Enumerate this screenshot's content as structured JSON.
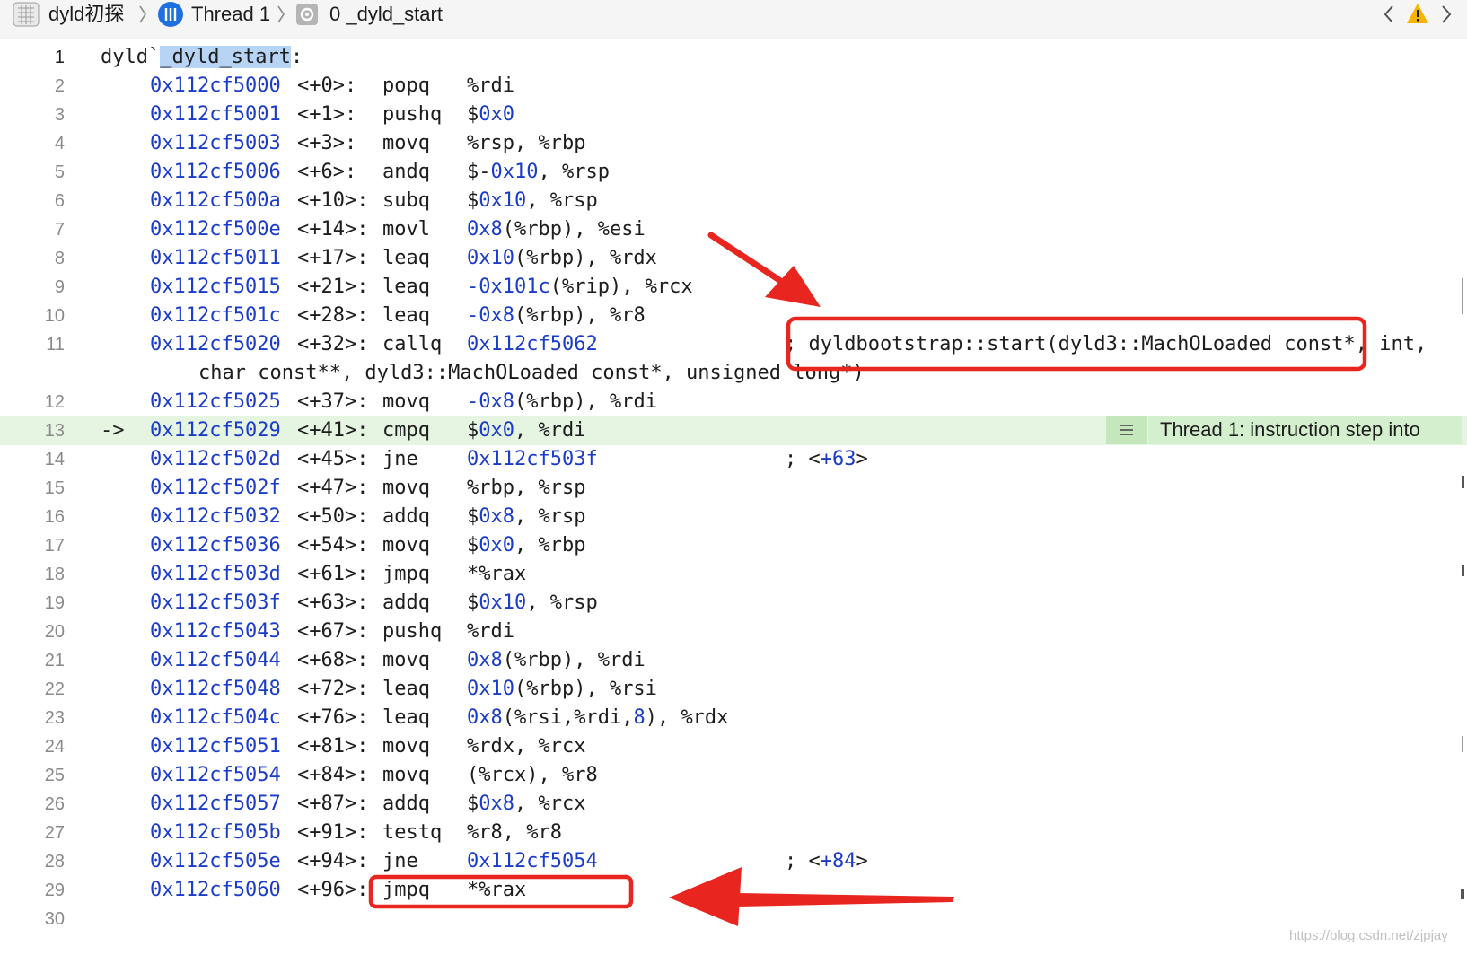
{
  "breadcrumb": {
    "project": "dyld初探",
    "thread": "Thread 1",
    "frame": "0 _dyld_start"
  },
  "banner": {
    "text": "Thread 1: instruction step into"
  },
  "lines": {
    "l1": {
      "num": "1",
      "prefix": "dyld`",
      "sym": "_dyld_start",
      "suffix": ":"
    },
    "l2": {
      "num": "2",
      "addr": "0x112cf5000",
      "off": "<+0>:",
      "op": "popq",
      "args": "%rdi"
    },
    "l3": {
      "num": "3",
      "addr": "0x112cf5001",
      "off": "<+1>:",
      "op": "pushq",
      "a1": "$",
      "a2": "0x0"
    },
    "l4": {
      "num": "4",
      "addr": "0x112cf5003",
      "off": "<+3>:",
      "op": "movq",
      "args": "%rsp, %rbp"
    },
    "l5": {
      "num": "5",
      "addr": "0x112cf5006",
      "off": "<+6>:",
      "op": "andq",
      "a1": "$-",
      "a2": "0x10",
      "a3": ", %rsp"
    },
    "l6": {
      "num": "6",
      "addr": "0x112cf500a",
      "off": "<+10>:",
      "op": "subq",
      "a1": "$",
      "a2": "0x10",
      "a3": ", %rsp"
    },
    "l7": {
      "num": "7",
      "addr": "0x112cf500e",
      "off": "<+14>:",
      "op": "movl",
      "a2": "0x8",
      "a3": "(%rbp), %esi"
    },
    "l8": {
      "num": "8",
      "addr": "0x112cf5011",
      "off": "<+17>:",
      "op": "leaq",
      "a2": "0x10",
      "a3": "(%rbp), %rdx"
    },
    "l9": {
      "num": "9",
      "addr": "0x112cf5015",
      "off": "<+21>:",
      "op": "leaq",
      "a1": "-",
      "a2": "0x101c",
      "a3": "(%rip), %rcx"
    },
    "l10": {
      "num": "10",
      "addr": "0x112cf501c",
      "off": "<+28>:",
      "op": "leaq",
      "a1": "-",
      "a2": "0x8",
      "a3": "(%rbp), %r8"
    },
    "l11": {
      "num": "11",
      "addr": "0x112cf5020",
      "off": "<+32>:",
      "op": "callq",
      "a2": "0x112cf5062",
      "comment": "; dyldbootstrap::start(dyld3::MachOLoaded const*, int,",
      "cont": "char const**, dyld3::MachOLoaded const*, unsigned long*)"
    },
    "l12": {
      "num": "12",
      "addr": "0x112cf5025",
      "off": "<+37>:",
      "op": "movq",
      "a1": "-",
      "a2": "0x8",
      "a3": "(%rbp), %rdi"
    },
    "l13": {
      "num": "13",
      "pc": "->",
      "addr": "0x112cf5029",
      "off": "<+41>:",
      "op": "cmpq",
      "a1": "$",
      "a2": "0x0",
      "a3": ", %rdi"
    },
    "l14": {
      "num": "14",
      "addr": "0x112cf502d",
      "off": "<+45>:",
      "op": "jne",
      "a2": "0x112cf503f",
      "comment_a": "; <",
      "comment_b": "+63",
      "comment_c": ">"
    },
    "l15": {
      "num": "15",
      "addr": "0x112cf502f",
      "off": "<+47>:",
      "op": "movq",
      "args": "%rbp, %rsp"
    },
    "l16": {
      "num": "16",
      "addr": "0x112cf5032",
      "off": "<+50>:",
      "op": "addq",
      "a1": "$",
      "a2": "0x8",
      "a3": ", %rsp"
    },
    "l17": {
      "num": "17",
      "addr": "0x112cf5036",
      "off": "<+54>:",
      "op": "movq",
      "a1": "$",
      "a2": "0x0",
      "a3": ", %rbp"
    },
    "l18": {
      "num": "18",
      "addr": "0x112cf503d",
      "off": "<+61>:",
      "op": "jmpq",
      "args": "*%rax"
    },
    "l19": {
      "num": "19",
      "addr": "0x112cf503f",
      "off": "<+63>:",
      "op": "addq",
      "a1": "$",
      "a2": "0x10",
      "a3": ", %rsp"
    },
    "l20": {
      "num": "20",
      "addr": "0x112cf5043",
      "off": "<+67>:",
      "op": "pushq",
      "args": "%rdi"
    },
    "l21": {
      "num": "21",
      "addr": "0x112cf5044",
      "off": "<+68>:",
      "op": "movq",
      "a2": "0x8",
      "a3": "(%rbp), %rdi"
    },
    "l22": {
      "num": "22",
      "addr": "0x112cf5048",
      "off": "<+72>:",
      "op": "leaq",
      "a2": "0x10",
      "a3": "(%rbp), %rsi"
    },
    "l23": {
      "num": "23",
      "addr": "0x112cf504c",
      "off": "<+76>:",
      "op": "leaq",
      "a2": "0x8",
      "a3": "(%rsi,%rdi,",
      "a4": "8",
      "a5": "), %rdx"
    },
    "l24": {
      "num": "24",
      "addr": "0x112cf5051",
      "off": "<+81>:",
      "op": "movq",
      "args": "%rdx, %rcx"
    },
    "l25": {
      "num": "25",
      "addr": "0x112cf5054",
      "off": "<+84>:",
      "op": "movq",
      "args": "(%rcx), %r8"
    },
    "l26": {
      "num": "26",
      "addr": "0x112cf5057",
      "off": "<+87>:",
      "op": "addq",
      "a1": "$",
      "a2": "0x8",
      "a3": ", %rcx"
    },
    "l27": {
      "num": "27",
      "addr": "0x112cf505b",
      "off": "<+91>:",
      "op": "testq",
      "args": "%r8, %r8"
    },
    "l28": {
      "num": "28",
      "addr": "0x112cf505e",
      "off": "<+94>:",
      "op": "jne",
      "a2": "0x112cf5054",
      "comment_a": "; <",
      "comment_b": "+84",
      "comment_c": ">"
    },
    "l29": {
      "num": "29",
      "addr": "0x112cf5060",
      "off": "<+96>:",
      "op": "jmpq",
      "args": "*%rax"
    },
    "l30": {
      "num": "30"
    }
  },
  "watermark": "https://blog.csdn.net/zjpjay",
  "colors": {
    "address": "#1a3cc8",
    "highlight_row": "#e6f4e2",
    "annotation": "#e8261f"
  }
}
